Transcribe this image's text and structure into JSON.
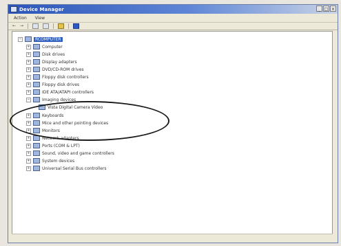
{
  "window": {
    "title": "Device Manager"
  },
  "menu": [
    "Action",
    "View"
  ],
  "tree": {
    "root": "RCOMPUTER",
    "items": [
      "Computer",
      "Disk drives",
      "Display adapters",
      "DVD/CD-ROM drives",
      "Floppy disk controllers",
      "Floppy disk drives",
      "IDE ATA/ATAPI controllers",
      "Imaging devices",
      "Vista Digital Camera Video",
      "Keyboards",
      "Mice and other pointing devices",
      "Monitors",
      "Network adapters",
      "Ports (COM & LPT)",
      "Sound, video and game controllers",
      "System devices",
      "Universal Serial Bus controllers"
    ]
  },
  "icons": {
    "window": "device-manager-icon",
    "back": "back-arrow-icon",
    "forward": "forward-arrow-icon"
  }
}
